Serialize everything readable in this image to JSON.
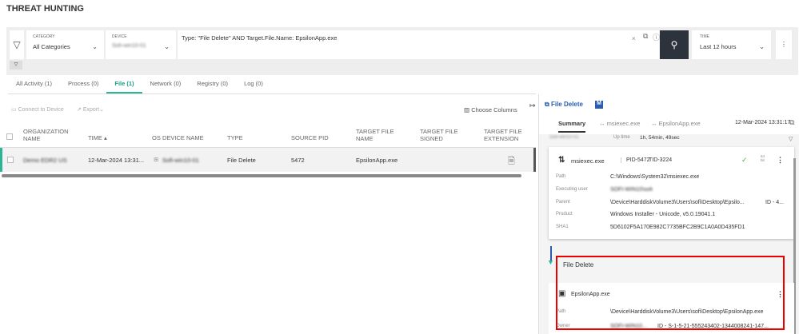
{
  "title": "THREAT HUNTING",
  "filter": {
    "category_label": "CATEGORY",
    "category_value": "All Categories",
    "device_label": "DEVICE",
    "device_value": "Sofi-win10-01",
    "query": "Type: \"File Delete\" AND Target.File.Name: EpsilonApp.exe",
    "time_label": "TIME",
    "time_value": "Last 12 hours"
  },
  "tabs": [
    {
      "label": "All Activity (1)"
    },
    {
      "label": "Process (0)"
    },
    {
      "label": "File (1)"
    },
    {
      "label": "Network (0)"
    },
    {
      "label": "Registry (0)"
    },
    {
      "label": "Log (0)"
    }
  ],
  "toolbar": {
    "connect": "Connect to Device",
    "export": "Export",
    "choose_columns": "Choose Columns"
  },
  "table": {
    "headers": [
      "ORGANIZATION NAME",
      "TIME",
      "OS",
      "DEVICE NAME",
      "TYPE",
      "SOURCE PID",
      "TARGET FILE NAME",
      "TARGET FILE SIGNED",
      "TARGET FILE EXTENSION"
    ],
    "row": {
      "org": "Demo EDR2 US",
      "time": "12-Mar-2024 13:31...",
      "device": "Sofi-win10-01",
      "type": "File Delete",
      "pid": "5472",
      "target": "EpsilonApp.exe"
    }
  },
  "panel": {
    "title": "File Delete",
    "badge": "M",
    "tabs": [
      "Summary",
      "msiexec.exe",
      "EpsilonApp.exe"
    ],
    "timestamp": "12-Mar-2024 13:31:17",
    "info": {
      "device": "Sofi-win10-01",
      "uptime_label": "Up time",
      "uptime": "1h, 54min, 49sec"
    },
    "process": {
      "name": "msiexec.exe",
      "pid": "PID-5472",
      "tid": "TID-3224",
      "arch": "64 bit",
      "fields": [
        {
          "label": "Path",
          "value": "C:\\Windows\\System32\\msiexec.exe"
        },
        {
          "label": "Executing user",
          "value": "SOFI-WIN10\\sofi"
        },
        {
          "label": "Parent",
          "value": "\\Device\\HarddiskVolume3\\Users\\sofi\\Desktop\\Epsilo...",
          "extra": "ID - 4..."
        },
        {
          "label": "Product",
          "value": "Windows Installer - Unicode, v5.0.19041.1"
        },
        {
          "label": "SHA1",
          "value": "5D6102F5A170E982C7735BFC2B9C1A0A0D435FD1"
        }
      ]
    },
    "event_title": "File Delete",
    "file": {
      "name": "EpsilonApp.exe",
      "path_label": "Path",
      "path": "\\Device\\HarddiskVolume3\\Users\\sofi\\Desktop\\EpsilonApp.exe",
      "owner_label": "Owner",
      "owner": "SOFI-WIN10...",
      "owner_id": "ID - S-1-5-21-555243402-1344008241-147..."
    }
  }
}
